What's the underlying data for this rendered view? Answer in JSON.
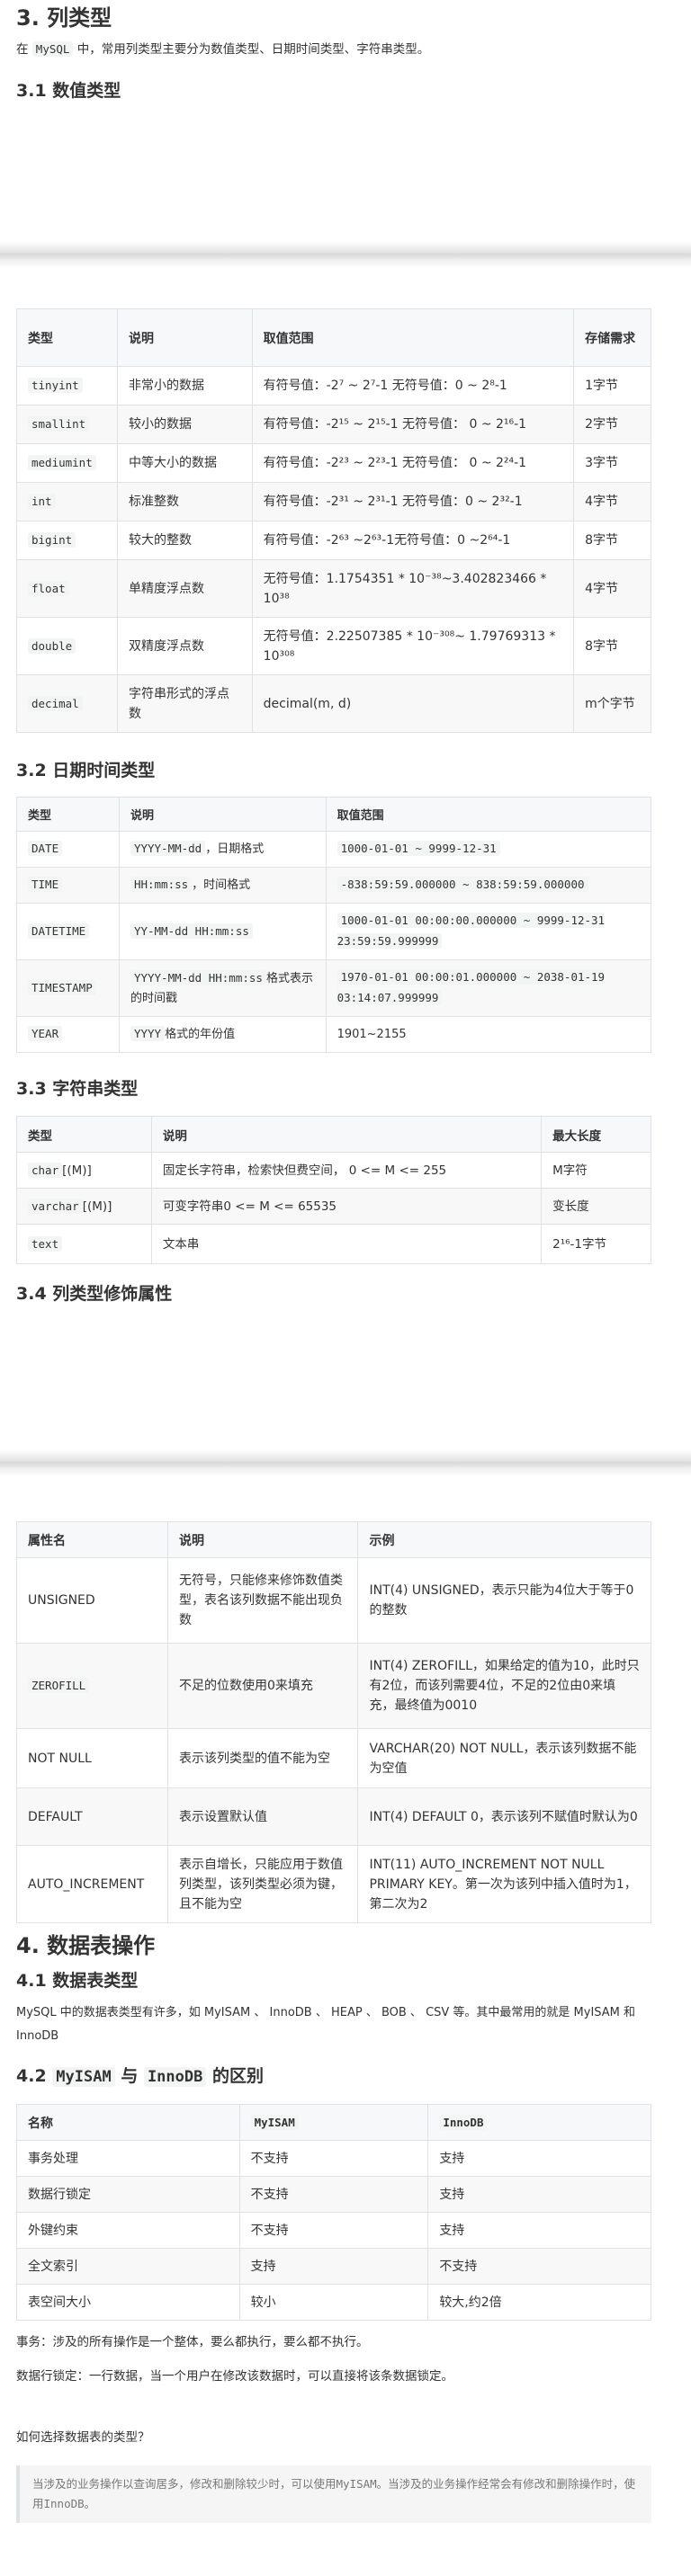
{
  "s3": {
    "title": "3. 列类型",
    "intro_pre": "在",
    "intro_code": "MySQL",
    "intro_post": "中，常用列类型主要分为数值类型、日期时间类型、字符串类型。",
    "numeric_title": "3.1 数值类型"
  },
  "numeric_table": {
    "headers": [
      "类型",
      "说明",
      "取值范围",
      "存储需求"
    ],
    "rows": [
      {
        "type": "tinyint",
        "desc": "非常小的数据",
        "range": "有符号值：-2⁷ ~ 2⁷-1 无符号值：0 ~ 2⁸-1",
        "store": "1字节"
      },
      {
        "type": "smallint",
        "desc": "较小的数据",
        "range": "有符号值：-2¹⁵ ~ 2¹⁵-1 无符号值： 0 ~ 2¹⁶-1",
        "store": "2字节"
      },
      {
        "type": "mediumint",
        "desc": "中等大小的数据",
        "range": "有符号值：-2²³ ~ 2²³-1 无符号值： 0 ~ 2²⁴-1",
        "store": "3字节"
      },
      {
        "type": "int",
        "desc": "标准整数",
        "range": "有符号值：-2³¹ ~ 2³¹-1 无符号值：0 ~ 2³²-1",
        "store": "4字节"
      },
      {
        "type": "bigint",
        "desc": "较大的整数",
        "range": "有符号值：-2⁶³ ~2⁶³-1无符号值：0 ~2⁶⁴-1",
        "store": "8字节"
      },
      {
        "type": "float",
        "desc": "单精度浮点数",
        "range": "无符号值：1.1754351 * 10⁻³⁸~3.402823466 * 10³⁸",
        "store": "4字节"
      },
      {
        "type": "double",
        "desc": "双精度浮点数",
        "range": "无符号值：2.22507385 * 10⁻³⁰⁸~ 1.79769313 * 10³⁰⁸",
        "store": "8字节"
      },
      {
        "type": "decimal",
        "desc": "字符串形式的浮点数",
        "range": "decimal(m, d)",
        "store": "m个字节"
      }
    ]
  },
  "datetime": {
    "title": "3.2 日期时间类型",
    "headers": [
      "类型",
      "说明",
      "取值范围"
    ],
    "rows": [
      {
        "type": "DATE",
        "fmt": "YYYY-MM-dd",
        "desc": "，日期格式",
        "range": "1000-01-01 ~ 9999-12-31"
      },
      {
        "type": "TIME",
        "fmt": "HH:mm:ss",
        "desc": "，时间格式",
        "range": "-838:59:59.000000 ~ 838:59:59.000000"
      },
      {
        "type": "DATETIME",
        "fmt": "YY-MM-dd HH:mm:ss",
        "desc": "",
        "range": "1000-01-01 00:00:00.000000 ~ 9999-12-31 23:59:59.999999"
      },
      {
        "type": "TIMESTAMP",
        "fmt": "YYYY-MM-dd HH:mm:ss",
        "desc": "格式表示的时间戳",
        "range": "1970-01-01 00:00:01.000000 ~ 2038-01-19 03:14:07.999999"
      },
      {
        "type": "YEAR",
        "fmt": "YYYY",
        "desc": "格式的年份值",
        "range": "1901~2155"
      }
    ]
  },
  "strings": {
    "title": "3.3 字符串类型",
    "headers": [
      "类型",
      "说明",
      "最大长度"
    ],
    "rows": [
      {
        "type": "char",
        "suffix": "[(M)]",
        "desc": "固定长字符串，检索快但费空间， 0 <= M <= 255",
        "max": "M字符"
      },
      {
        "type": "varchar",
        "suffix": "[(M)]",
        "desc": "可变字符串0 <= M <= 65535",
        "max": "变长度"
      },
      {
        "type": "text",
        "suffix": "",
        "desc": "文本串",
        "max": "2¹⁶-1字节"
      }
    ]
  },
  "modifiers": {
    "title": "3.4 列类型修饰属性",
    "headers": [
      "属性名",
      "说明",
      "示例"
    ],
    "rows": [
      {
        "name": "UNSIGNED",
        "desc": "无符号，只能修来修饰数值类型，表名该列数据不能出现负数",
        "example": "INT(4) UNSIGNED，表示只能为4位大于等于0的整数"
      },
      {
        "name": "ZEROFILL",
        "desc": "不足的位数使用0来填充",
        "example": "INT(4) ZEROFILL，如果给定的值为10，此时只有2位，而该列需要4位，不足的2位由0来填充，最终值为0010"
      },
      {
        "name": "NOT NULL",
        "desc": "表示该列类型的值不能为空",
        "example": "VARCHAR(20) NOT NULL，表示该列数据不能为空值"
      },
      {
        "name": "DEFAULT",
        "desc": "表示设置默认值",
        "example": "INT(4) DEFAULT 0，表示该列不赋值时默认为0"
      },
      {
        "name": "AUTO_INCREMENT",
        "desc": "表示自增长，只能应用于数值列类型，该列类型必须为键，且不能为空",
        "example": "INT(11) AUTO_INCREMENT NOT NULL PRIMARY KEY。第一次为该列中插入值时为1，第二次为2"
      }
    ]
  },
  "s4": {
    "title": "4. 数据表操作",
    "types_title": "4.1 数据表类型",
    "types_text": "MySQL 中的数据表类型有许多，如 MyISAM 、 InnoDB 、 HEAP 、 BOB 、 CSV 等。其中最常用的就是 MyISAM 和 InnoDB",
    "diff_title_pre": "4.2 ",
    "diff_title_code1": "MyISAM",
    "diff_title_mid": " 与 ",
    "diff_title_code2": "InnoDB",
    "diff_title_post": " 的区别"
  },
  "diff_table": {
    "headers": [
      "名称",
      "MyISAM",
      "InnoDB"
    ],
    "rows": [
      [
        "事务处理",
        "不支持",
        "支持"
      ],
      [
        "数据行锁定",
        "不支持",
        "支持"
      ],
      [
        "外键约束",
        "不支持",
        "支持"
      ],
      [
        "全文索引",
        "支持",
        "不支持"
      ],
      [
        "表空间大小",
        "较小",
        "较大,约2倍"
      ]
    ]
  },
  "notes": {
    "transaction": "事务：涉及的所有操作是一个整体，要么都执行，要么都不执行。",
    "rowlock": "数据行锁定：一行数据，当一个用户在修改该数据时，可以直接将该条数据锁定。",
    "question": "如何选择数据表的类型？",
    "quote": "当涉及的业务操作以查询居多，修改和删除较少时，可以使用MyISAM。当涉及的业务操作经常会有修改和删除操作时，使用InnoDB。"
  }
}
